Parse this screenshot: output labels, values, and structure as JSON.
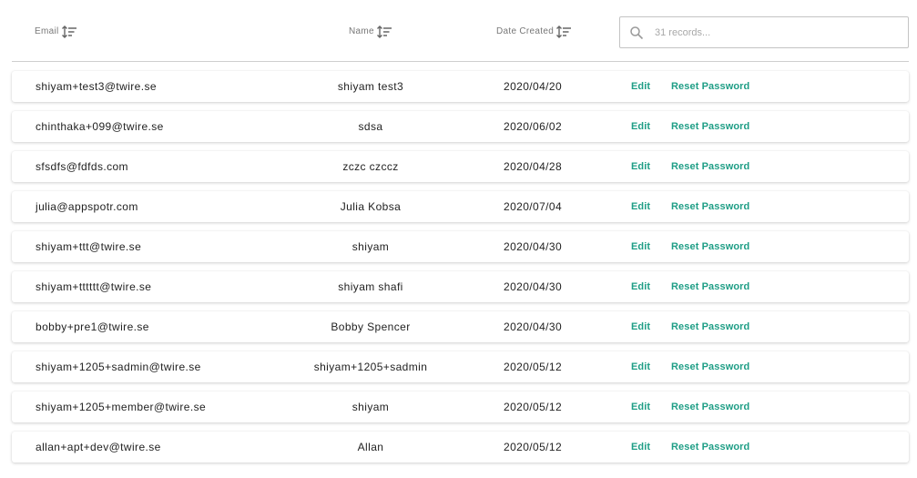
{
  "table": {
    "columns": {
      "email": "Email",
      "name": "Name",
      "date_created": "Date Created"
    },
    "search": {
      "placeholder": "31 records...",
      "value": ""
    },
    "actions": {
      "edit": "Edit",
      "reset_password": "Reset Password"
    },
    "accent_color": "#1f9e86",
    "rows": [
      {
        "email": "shiyam+test3@twire.se",
        "name": "shiyam test3",
        "date": "2020/04/20"
      },
      {
        "email": "chinthaka+099@twire.se",
        "name": "sdsa",
        "date": "2020/06/02"
      },
      {
        "email": "sfsdfs@fdfds.com",
        "name": "zczc czccz",
        "date": "2020/04/28"
      },
      {
        "email": "julia@appspotr.com",
        "name": "Julia Kobsa",
        "date": "2020/07/04"
      },
      {
        "email": "shiyam+ttt@twire.se",
        "name": "shiyam",
        "date": "2020/04/30"
      },
      {
        "email": "shiyam+tttttt@twire.se",
        "name": "shiyam shafi",
        "date": "2020/04/30"
      },
      {
        "email": "bobby+pre1@twire.se",
        "name": "Bobby Spencer",
        "date": "2020/04/30"
      },
      {
        "email": "shiyam+1205+sadmin@twire.se",
        "name": "shiyam+1205+sadmin",
        "date": "2020/05/12"
      },
      {
        "email": "shiyam+1205+member@twire.se",
        "name": "shiyam",
        "date": "2020/05/12"
      },
      {
        "email": "allan+apt+dev@twire.se",
        "name": "Allan",
        "date": "2020/05/12"
      }
    ]
  }
}
